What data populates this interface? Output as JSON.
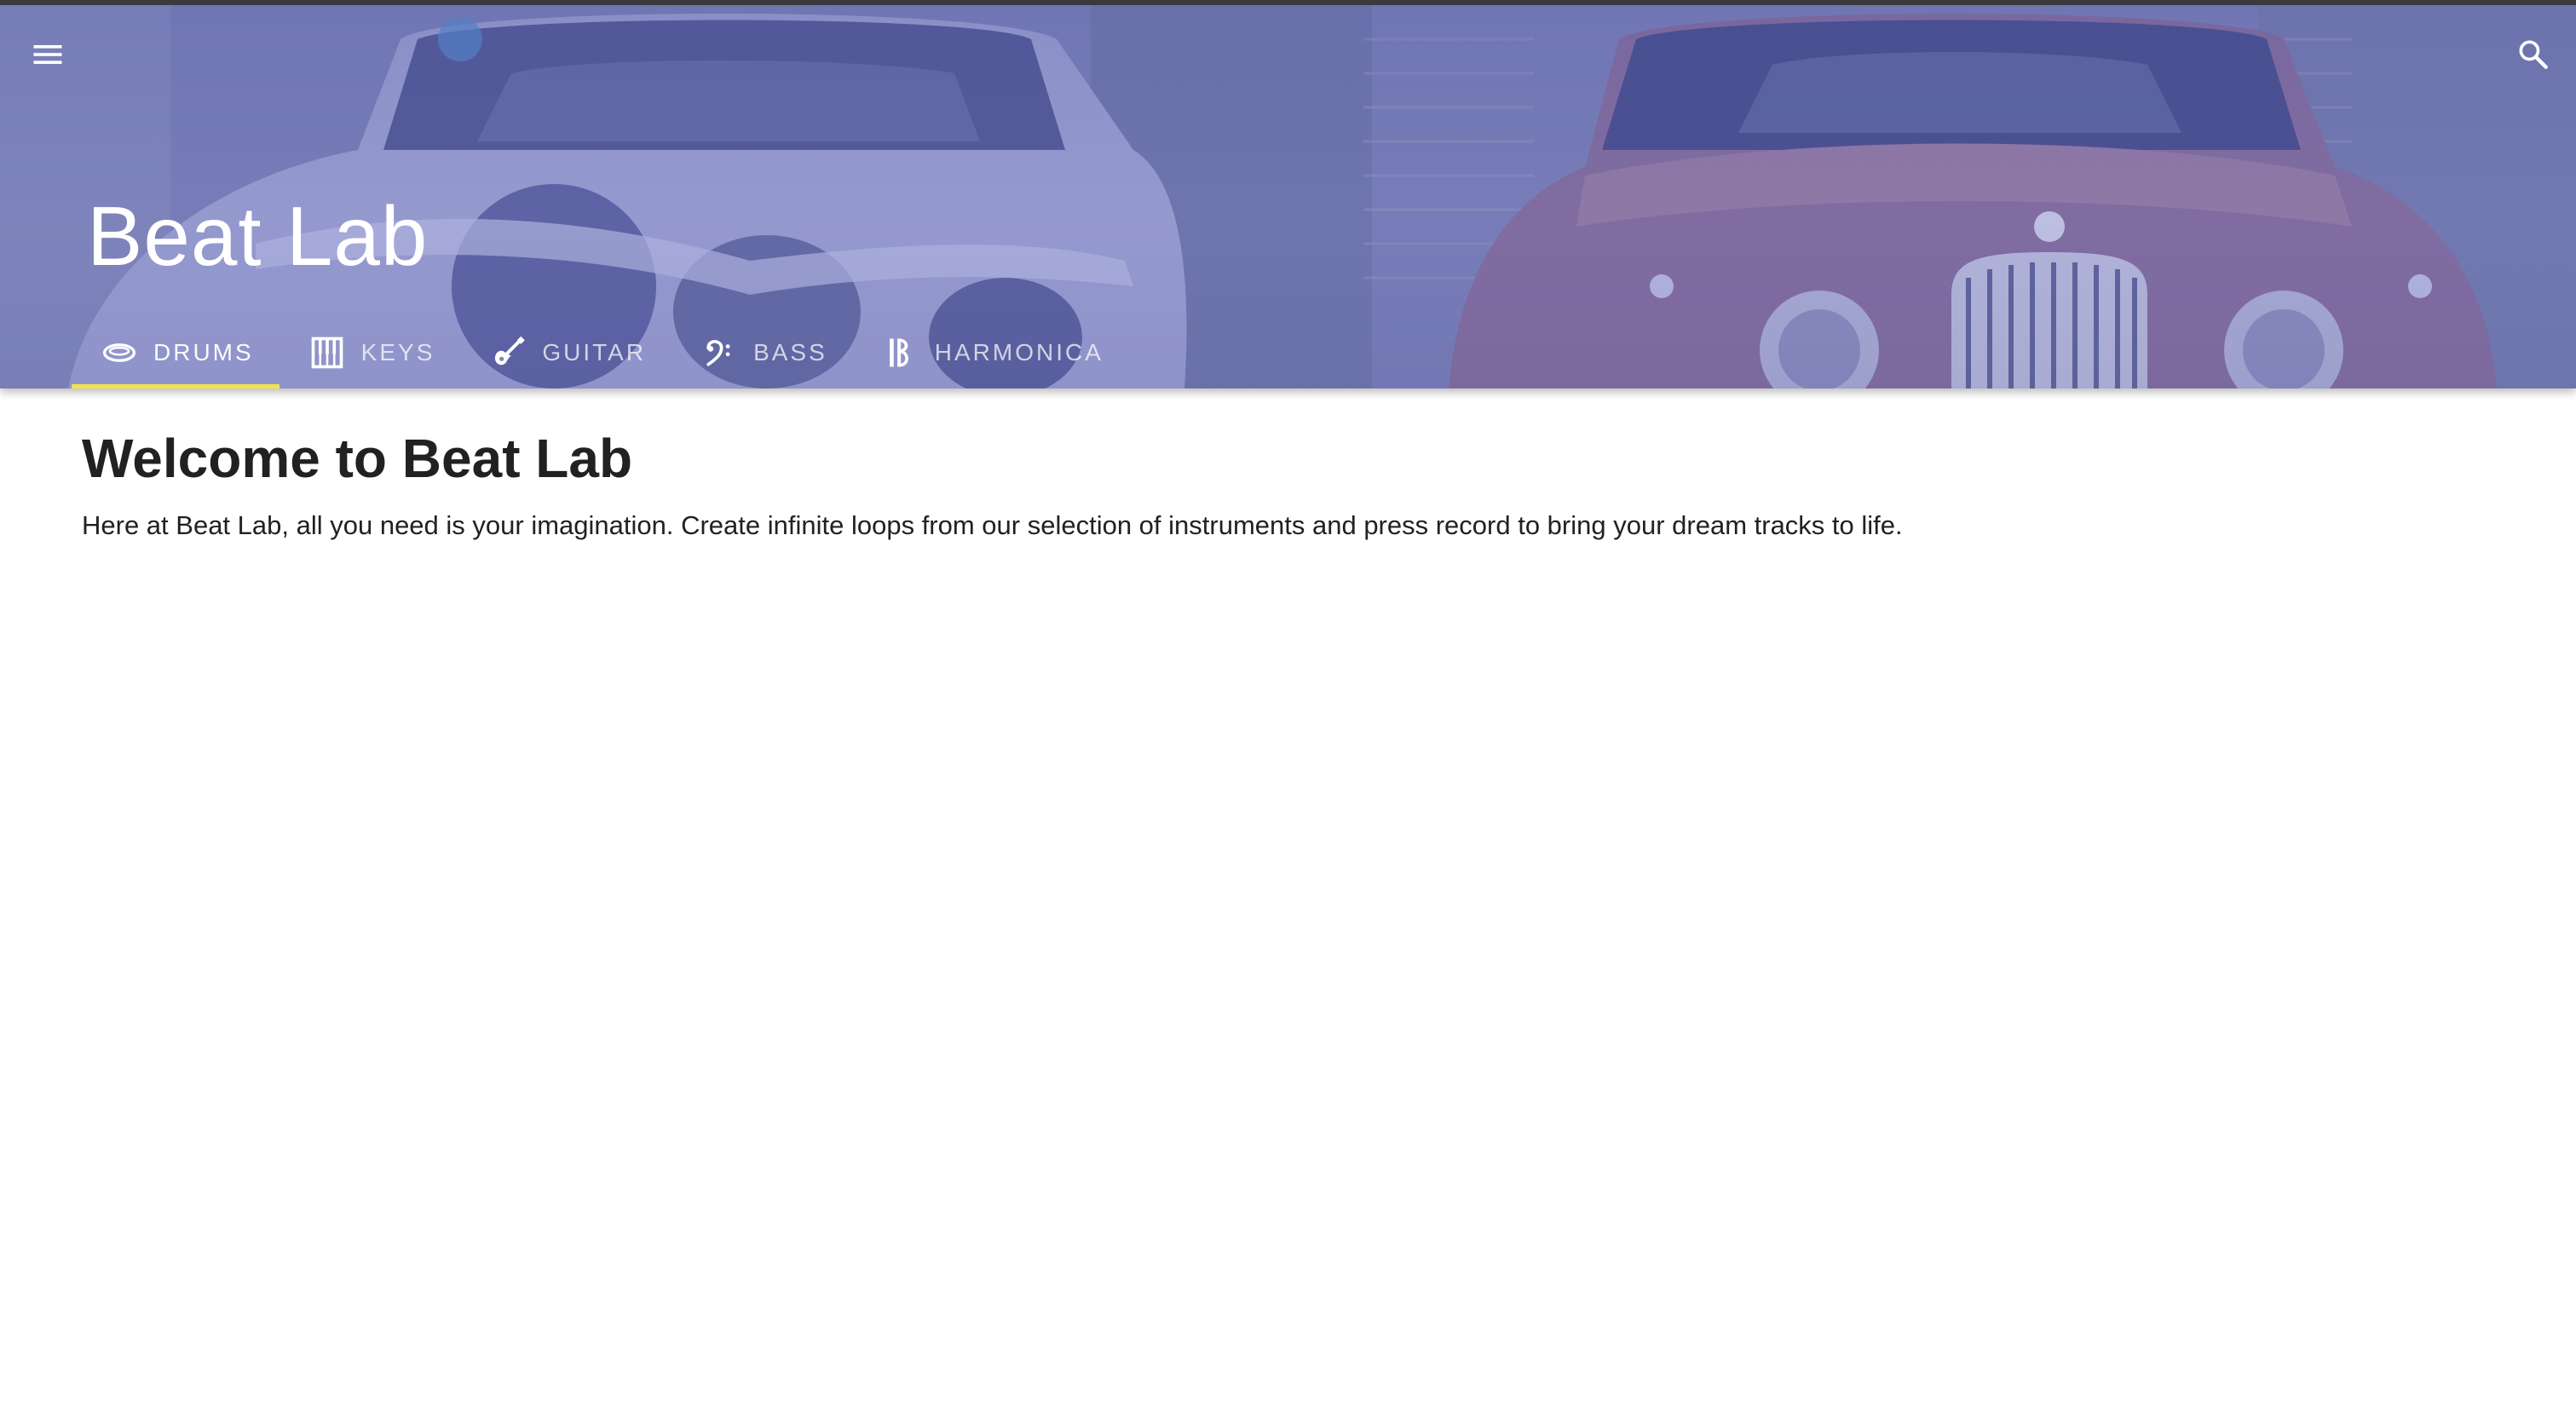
{
  "header": {
    "title": "Beat Lab",
    "menu_icon": "menu-icon",
    "search_icon": "search-icon",
    "overlay_color": "#6f76b4",
    "indicator_color": "#f2e34c"
  },
  "tabs": [
    {
      "label": "DRUMS",
      "icon": "drum-icon",
      "active": true
    },
    {
      "label": "KEYS",
      "icon": "piano-keys-icon",
      "active": false
    },
    {
      "label": "GUITAR",
      "icon": "guitar-icon",
      "active": false
    },
    {
      "label": "BASS",
      "icon": "bass-clef-icon",
      "active": false
    },
    {
      "label": "HARMONICA",
      "icon": "harmonica-icon",
      "active": false
    }
  ],
  "main": {
    "heading": "Welcome to Beat Lab",
    "intro": "Here at Beat Lab, all you need is your imagination. Create infinite loops from our selection of instruments and press record to bring your dream tracks to life."
  }
}
